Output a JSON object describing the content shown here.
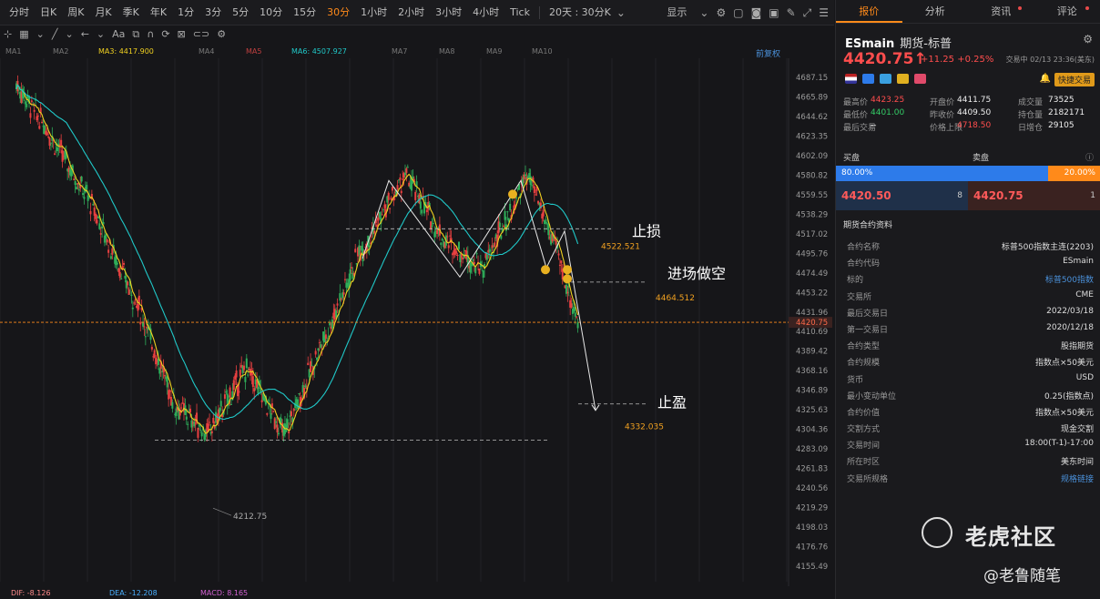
{
  "toolbar": {
    "periods": [
      "分时",
      "日K",
      "周K",
      "月K",
      "季K",
      "年K",
      "1分",
      "3分",
      "5分",
      "10分",
      "15分",
      "30分",
      "1小时",
      "2小时",
      "3小时",
      "4小时",
      "Tick"
    ],
    "active_period": "30分",
    "range_label": "20天 : 30分K",
    "display_label": "显示"
  },
  "ma": {
    "labels": [
      "MA1",
      "MA2",
      "MA3: 4417.900",
      "MA4",
      "MA5",
      "MA6: 4507.927",
      "MA7",
      "MA8",
      "MA9",
      "MA10"
    ],
    "colors": [
      "#777",
      "#777",
      "#f0d020",
      "#777",
      "#c04040",
      "#20c8c8",
      "#777",
      "#777",
      "#777",
      "#777"
    ],
    "adjust_label": "前复权"
  },
  "chart_data": {
    "type": "candlestick",
    "y_ticks": [
      "4687.15",
      "4665.89",
      "4644.62",
      "4623.35",
      "4602.09",
      "4580.82",
      "4559.55",
      "4538.29",
      "4517.02",
      "4495.76",
      "4474.49",
      "4453.22",
      "4431.96",
      "4410.69",
      "4389.42",
      "4368.16",
      "4346.89",
      "4325.63",
      "4304.36",
      "4283.09",
      "4261.83",
      "4240.56",
      "4219.29",
      "4198.03",
      "4176.76",
      "4155.49"
    ],
    "ylim": [
      4155.49,
      4687.15
    ],
    "current_price": "4420.75",
    "low_label": "4212.75",
    "annotations": [
      {
        "text": "止损",
        "value": "4522.521"
      },
      {
        "text": "进场做空",
        "value": "4464.512"
      },
      {
        "text": "止盈",
        "value": "4332.035"
      }
    ],
    "key_prices": [
      4212.75,
      4522.521,
      4464.512,
      4332.035,
      4292.5,
      4420.75
    ]
  },
  "macd": {
    "dif": "DIF: -8.126",
    "dea": "DEA: -12.208",
    "macd": "MACD: 8.165"
  },
  "panel": {
    "tabs": [
      "报价",
      "分析",
      "资讯",
      "评论"
    ],
    "symbol": "ESmain",
    "name": "期货-标普",
    "price": "4420.75",
    "arrow": "↑",
    "change": "+11.25",
    "change_pct": "+0.25%",
    "status": "交易中 02/13 23:36(美东)",
    "quick_trade": "快捷交易",
    "stats": [
      [
        "最高价",
        "4423.25",
        "开盘价",
        "4411.75",
        "成交量",
        "73525"
      ],
      [
        "最低价",
        "4401.00",
        "昨收价",
        "4409.50",
        "持仓量",
        "2182171"
      ],
      [
        "最后交易",
        "--",
        "价格上限",
        "4718.50",
        "日增仓",
        "29105"
      ]
    ],
    "buy_label": "买盘",
    "sell_label": "卖盘",
    "buy_pct": "80.00%",
    "sell_pct": "20.00%",
    "bid_price": "4420.50",
    "bid_qty": "8",
    "ask_price": "4420.75",
    "ask_qty": "1",
    "info_title": "期货合约资料",
    "info": [
      [
        "合约名称",
        "标普500指数主连(2203)"
      ],
      [
        "合约代码",
        "ESmain"
      ],
      [
        "标的",
        "标普500指数"
      ],
      [
        "交易所",
        "CME"
      ],
      [
        "最后交易日",
        "2022/03/18"
      ],
      [
        "第一交易日",
        "2020/12/18"
      ],
      [
        "合约类型",
        "股指期货"
      ],
      [
        "合约规模",
        "指数点×50美元"
      ],
      [
        "货币",
        "USD"
      ],
      [
        "最小变动单位",
        "0.25(指数点)"
      ],
      [
        "合约价值",
        "指数点×50美元"
      ],
      [
        "交割方式",
        "现金交割"
      ],
      [
        "交易时间",
        "18:00(T-1)-17:00"
      ],
      [
        "所在时区",
        "美东时间"
      ],
      [
        "交易所规格",
        "规格链接"
      ]
    ]
  },
  "watermark": {
    "brand": "老虎社区",
    "author": "@老鲁随笔"
  }
}
